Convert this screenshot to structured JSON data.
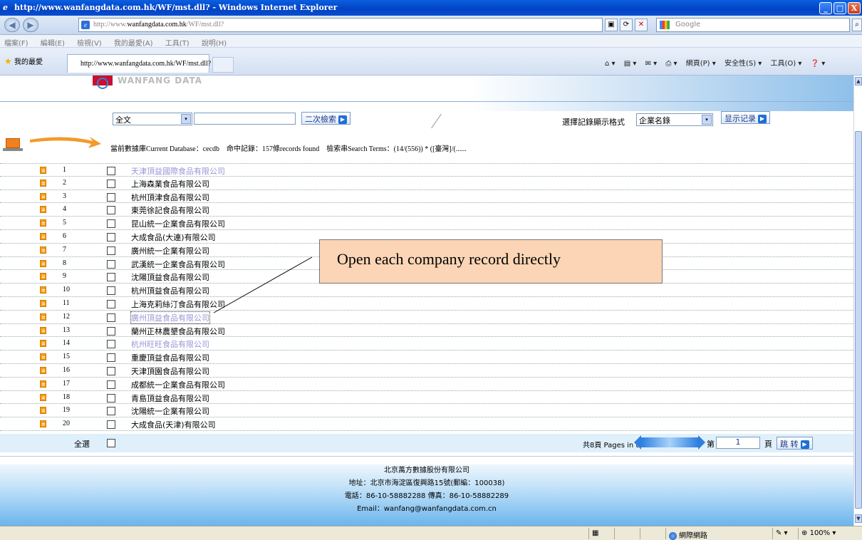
{
  "window": {
    "title": "http://www.wanfangdata.com.hk/WF/mst.dll? - Windows Internet Explorer",
    "min": "_",
    "max": "□",
    "close": "X"
  },
  "nav": {
    "back": "◀",
    "forward": "▶",
    "address_gray": "http://www.",
    "address_domain": "wanfangdata.com.hk",
    "address_path": "/WF/mst.dll?",
    "search_placeholder": "Google",
    "search_go": "⌕"
  },
  "menu": [
    "檔案(F)",
    "編輯(E)",
    "檢視(V)",
    "我的最愛(A)",
    "工具(T)",
    "說明(H)"
  ],
  "favorites": {
    "label": "我的最愛",
    "tab_title": "http://www.wanfangdata.com.hk/WF/mst.dll?",
    "commands": [
      "網頁(P) ▾",
      "安全性(S) ▾",
      "工具(O) ▾",
      "❓ ▾"
    ]
  },
  "site": {
    "logo_text": "WANFANG DATA",
    "search_scope": "全文",
    "search_scope_arrow": "▾",
    "search_value": "",
    "secondary_search": "二次檢索",
    "format_label": "選擇記錄顯示格式",
    "format_value": "企業名錄",
    "show_records": "显示记录",
    "go_glyph": "▶",
    "db_info": "當前數據庫Current Database：cecdb　命中記錄：157條records found　檢索串Search Terms：(14/(556)) * ([臺灣]/(......"
  },
  "records": [
    {
      "num": "1",
      "name": "天津頂益國際食品有限公司",
      "state": "visited"
    },
    {
      "num": "2",
      "name": "上海森業食品有限公司",
      "state": ""
    },
    {
      "num": "3",
      "name": "杭州頂津食品有限公司",
      "state": ""
    },
    {
      "num": "4",
      "name": "東莞徐記食品有限公司",
      "state": ""
    },
    {
      "num": "5",
      "name": "昆山統一企業食品有限公司",
      "state": ""
    },
    {
      "num": "6",
      "name": "大成食品(大連)有限公司",
      "state": ""
    },
    {
      "num": "7",
      "name": "廣州統一企業有限公司",
      "state": ""
    },
    {
      "num": "8",
      "name": "武漢統一企業食品有限公司",
      "state": ""
    },
    {
      "num": "9",
      "name": "沈陽頂益食品有限公司",
      "state": ""
    },
    {
      "num": "10",
      "name": "杭州頂益食品有限公司",
      "state": ""
    },
    {
      "num": "11",
      "name": "上海克莉絲汀食品有限公司",
      "state": ""
    },
    {
      "num": "12",
      "name": "廣州頂益食品有限公司",
      "state": "focused"
    },
    {
      "num": "13",
      "name": "蘭州正林農墾食品有限公司",
      "state": ""
    },
    {
      "num": "14",
      "name": "杭州旺旺食品有限公司",
      "state": "visited"
    },
    {
      "num": "15",
      "name": "重慶頂益食品有限公司",
      "state": ""
    },
    {
      "num": "16",
      "name": "天津頂園食品有限公司",
      "state": ""
    },
    {
      "num": "17",
      "name": "成都統一企業食品有限公司",
      "state": ""
    },
    {
      "num": "18",
      "name": "青島頂益食品有限公司",
      "state": ""
    },
    {
      "num": "19",
      "name": "沈陽統一企業有限公司",
      "state": ""
    },
    {
      "num": "20",
      "name": "大成食品(天津)有限公司",
      "state": ""
    }
  ],
  "pager": {
    "select_all": "全選",
    "total_pages": "共8頁 Pages in total",
    "di": "第",
    "page_value": "1",
    "ye": "頁",
    "jump": "跳 转"
  },
  "footer": {
    "company": "北京萬方數據股份有限公司",
    "address": "地址：北京市海淀區復興路15號(郵編：100038)",
    "phone": "電話：86-10-58882288 傳真：86-10-58882289",
    "email": "Email：wanfang@wanfangdata.com.cn"
  },
  "callout": "Open each company record directly",
  "status": {
    "zone": "網際網路",
    "zoom": "100%"
  }
}
